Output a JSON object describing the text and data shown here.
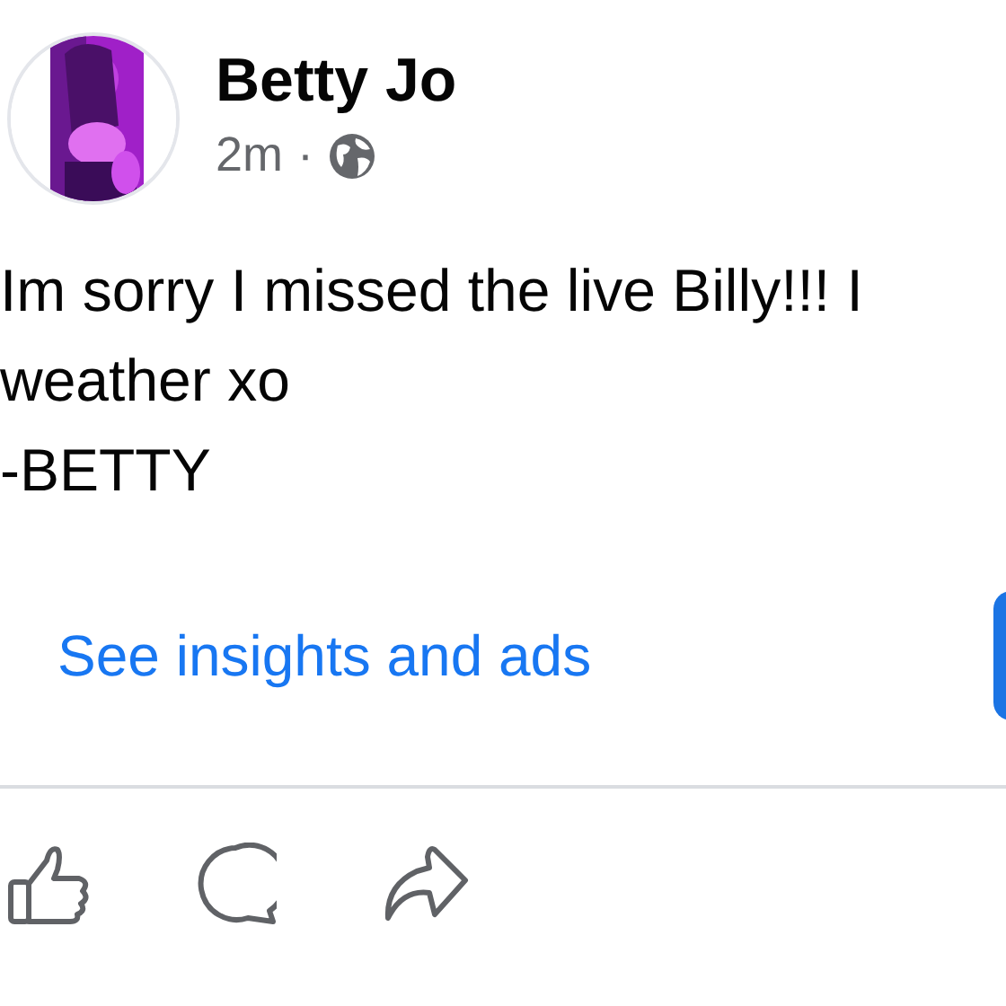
{
  "post": {
    "author": "Betty Jo",
    "time": "2m",
    "separator": "·",
    "text": "Im sorry I missed the live Billy!!! I\nweather xo\n-BETTY",
    "insights_link": "See insights and ads"
  }
}
